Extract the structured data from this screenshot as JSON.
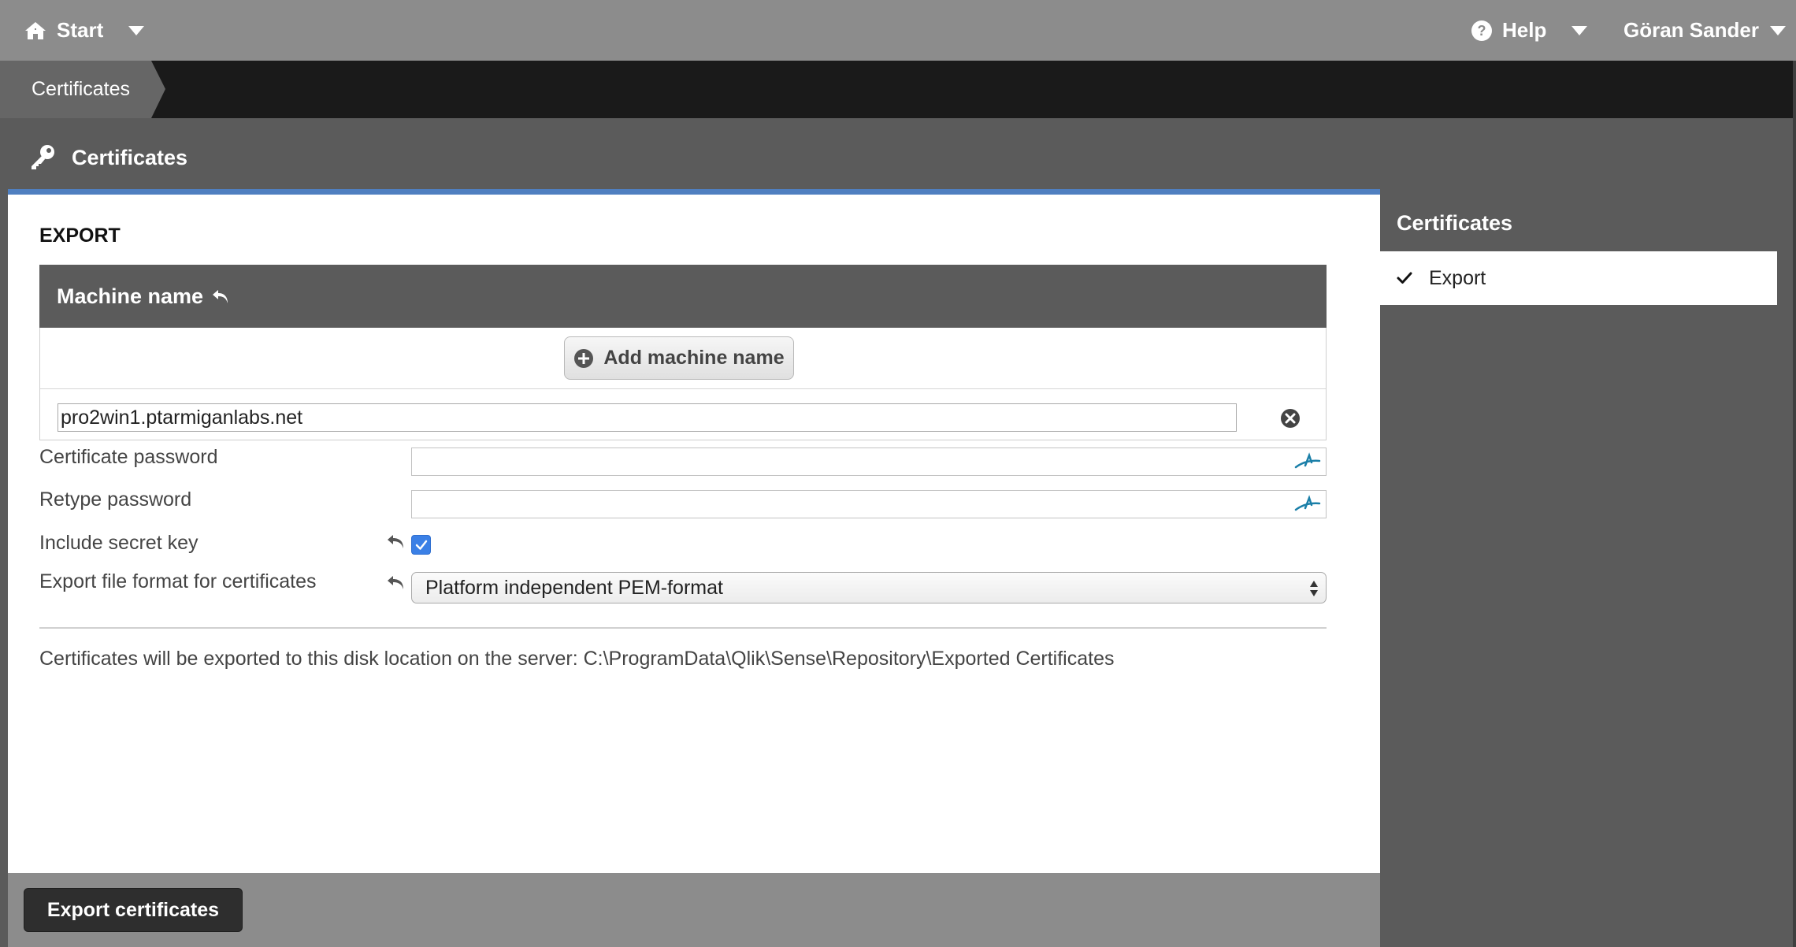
{
  "topbar": {
    "start_label": "Start",
    "help_label": "Help",
    "user_label": "Göran Sander"
  },
  "breadcrumb": {
    "current": "Certificates"
  },
  "page": {
    "title": "Certificates"
  },
  "export_section": {
    "title": "EXPORT",
    "machine_name_header": "Machine name",
    "add_machine_button": "Add machine name",
    "machine_name_value": "pro2win1.ptarmiganlabs.net",
    "certificate_password_label": "Certificate password",
    "certificate_password_value": "",
    "retype_password_label": "Retype password",
    "retype_password_value": "",
    "include_secret_key_label": "Include secret key",
    "include_secret_key_checked": true,
    "export_format_label": "Export file format for certificates",
    "export_format_selected": "Platform independent PEM-format",
    "info_text": "Certificates will be exported to this disk location on the server: C:\\ProgramData\\Qlik\\Sense\\Repository\\Exported Certificates"
  },
  "footer": {
    "export_button": "Export certificates"
  },
  "right_panel": {
    "title": "Certificates",
    "items": [
      {
        "label": "Export",
        "selected": true
      }
    ]
  },
  "colors": {
    "topbar": "#8c8c8c",
    "breadcrumb_bar": "#1a1a1a",
    "panel_dark": "#5b5b5b",
    "accent_blue": "#4f7fc0",
    "checkbox_blue": "#3b80e6",
    "password_icon_teal": "#1a7fa8"
  }
}
